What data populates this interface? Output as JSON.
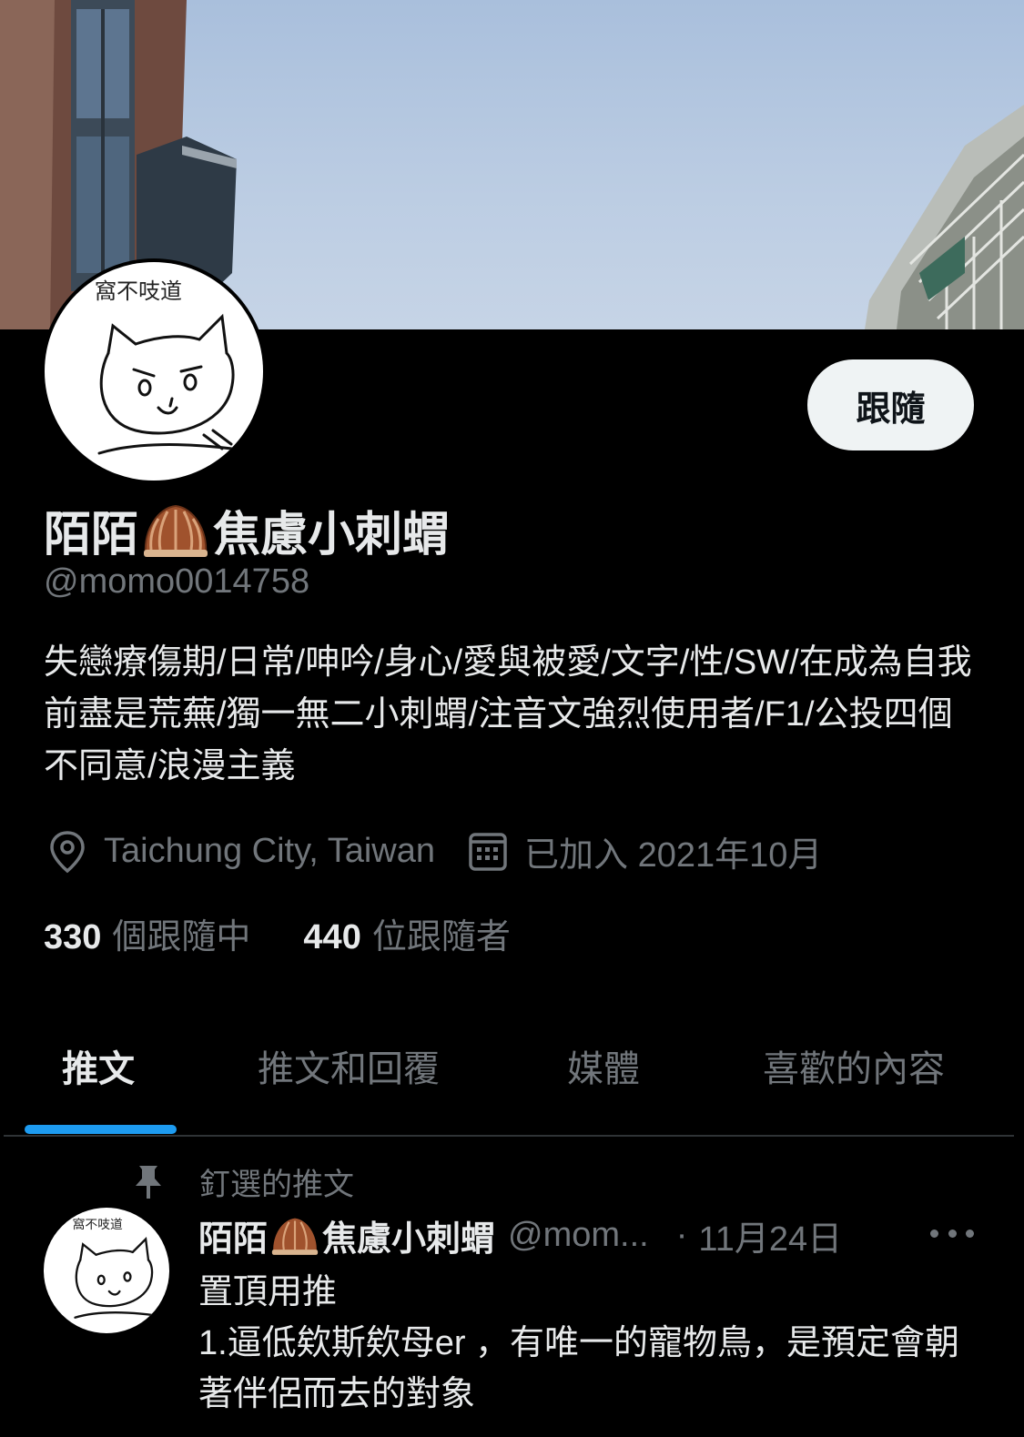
{
  "profile": {
    "name_prefix": "陌陌",
    "name_suffix": "焦慮小刺蝟",
    "name_emoji": "chestnut-emoji",
    "handle": "@momo0014758",
    "follow_label": "跟隨",
    "avatar_caption": "窩不吱道",
    "bio": "失戀療傷期/日常/呻吟/身心/愛與被愛/文字/性/SW/在成為自我前盡是荒蕪/獨一無二小刺蝟/注音文強烈使用者/F1/公投四個不同意/浪漫主義",
    "location": "Taichung City, Taiwan",
    "joined": "已加入 2021年10月",
    "following_count": "330",
    "following_label": "個跟隨中",
    "followers_count": "440",
    "followers_label": "位跟隨者"
  },
  "tabs": [
    {
      "label": "推文",
      "active": true
    },
    {
      "label": "推文和回覆",
      "active": false
    },
    {
      "label": "媒體",
      "active": false
    },
    {
      "label": "喜歡的內容",
      "active": false
    }
  ],
  "pinned_tweet": {
    "pinned_label": "釘選的推文",
    "name_prefix": "陌陌",
    "name_suffix": "焦慮小刺蝟",
    "handle": "@mom...",
    "dot": "·",
    "date": "11月24日",
    "line1": "置頂用推",
    "line2": "1.逼低欸斯欸母er ，有唯一的寵物鳥，是預定會朝著伴侶而去的對象"
  },
  "colors": {
    "background": "#000000",
    "accent": "#1d9bf0",
    "secondary_text": "#71767b",
    "follow_button_bg": "#eff3f4"
  }
}
